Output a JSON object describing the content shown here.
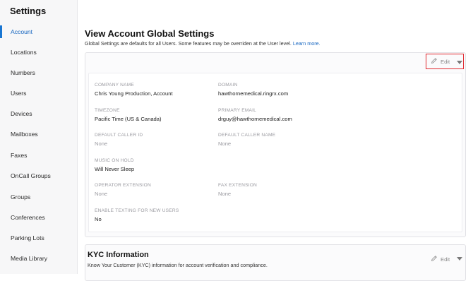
{
  "sidebar": {
    "title": "Settings",
    "items": [
      {
        "label": "Account",
        "active": true
      },
      {
        "label": "Locations"
      },
      {
        "label": "Numbers"
      },
      {
        "label": "Users"
      },
      {
        "label": "Devices"
      },
      {
        "label": "Mailboxes"
      },
      {
        "label": "Faxes"
      },
      {
        "label": "OnCall Groups"
      },
      {
        "label": "Groups"
      },
      {
        "label": "Conferences"
      },
      {
        "label": "Parking Lots"
      },
      {
        "label": "Media Library"
      }
    ]
  },
  "main": {
    "title": "View Account Global Settings",
    "subtitle": "Global Settings are defaults for all Users. Some features may be overriden at the User level.",
    "learn_more": "Learn more.",
    "edit_label": "Edit",
    "fields": {
      "company_name": {
        "label": "COMPANY NAME",
        "value": "Chris Young Production, Account"
      },
      "domain": {
        "label": "DOMAIN",
        "value": "hawthornemedical.ringrx.com"
      },
      "timezone": {
        "label": "TIMEZONE",
        "value": "Pacific Time (US & Canada)"
      },
      "primary_email": {
        "label": "PRIMARY EMAIL",
        "value": "drguy@hawthornemedical.com"
      },
      "default_caller_id": {
        "label": "DEFAULT CALLER ID",
        "value": "None"
      },
      "default_caller_name": {
        "label": "DEFAULT CALLER NAME",
        "value": "None"
      },
      "music_on_hold": {
        "label": "MUSIC ON HOLD",
        "value": "Will Never Sleep"
      },
      "operator_extension": {
        "label": "OPERATOR EXTENSION",
        "value": "None"
      },
      "fax_extension": {
        "label": "FAX EXTENSION",
        "value": "None"
      },
      "enable_texting": {
        "label": "ENABLE TEXTING FOR NEW USERS",
        "value": "No"
      }
    }
  },
  "kyc": {
    "title": "KYC Information",
    "subtitle": "Know Your Customer (KYC) information for account verification and compliance.",
    "edit_label": "Edit"
  },
  "colors": {
    "accent": "#1976d2",
    "highlight_box": "#e0282e"
  }
}
